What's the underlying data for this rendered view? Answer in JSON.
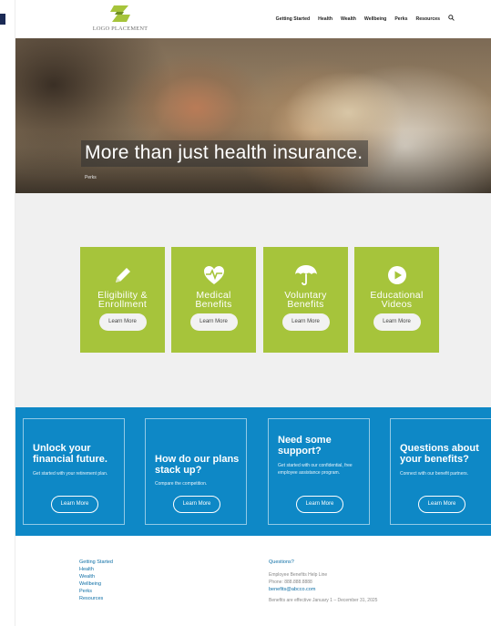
{
  "colors": {
    "accent_green": "#a6c43b",
    "brand_blue": "#0e88c6",
    "link_blue": "#0e6fa6"
  },
  "logo": {
    "text": "LOGO PLACEMENT"
  },
  "nav": {
    "items": [
      "Getting Started",
      "Health",
      "Wealth",
      "Wellbeing",
      "Perks",
      "Resources"
    ],
    "search_icon": "search-icon"
  },
  "hero": {
    "title": "More than just health insurance.",
    "crumb": "Perks"
  },
  "cards": [
    {
      "title_line1": "Eligibility &",
      "title_line2": "Enrollment",
      "icon": "pencil-icon",
      "button": "Learn More"
    },
    {
      "title_line1": "Medical",
      "title_line2": "Benefits",
      "icon": "heart-pulse-icon",
      "button": "Learn More"
    },
    {
      "title_line1": "Voluntary",
      "title_line2": "Benefits",
      "icon": "umbrella-icon",
      "button": "Learn More"
    },
    {
      "title_line1": "Educational",
      "title_line2": "Videos",
      "icon": "play-icon",
      "button": "Learn More"
    }
  ],
  "promos": [
    {
      "title": "Unlock your financial future.",
      "text": "Get started with your retirement plan.",
      "button": "Learn More"
    },
    {
      "title": "How do our plans stack up?",
      "text": "Compare the competition.",
      "button": "Learn More"
    },
    {
      "title": "Need some support?",
      "text": "Get started with our confidential, free employee assistance program.",
      "button": "Learn More"
    },
    {
      "title": "Questions about your benefits?",
      "text": "Connect with our benefit partners.",
      "button": "Learn More"
    }
  ],
  "footer": {
    "links": [
      "Getting Started",
      "Health",
      "Wealth",
      "Wellbeing",
      "Perks",
      "Resources"
    ],
    "questions_heading": "Questions?",
    "helpline": "Employee Benefits Help Line",
    "phone": "Phone: 888.888.8888",
    "email": "benefits@abcco.com",
    "effective": "Benefits are effective January 1 – December 31, 2025"
  }
}
